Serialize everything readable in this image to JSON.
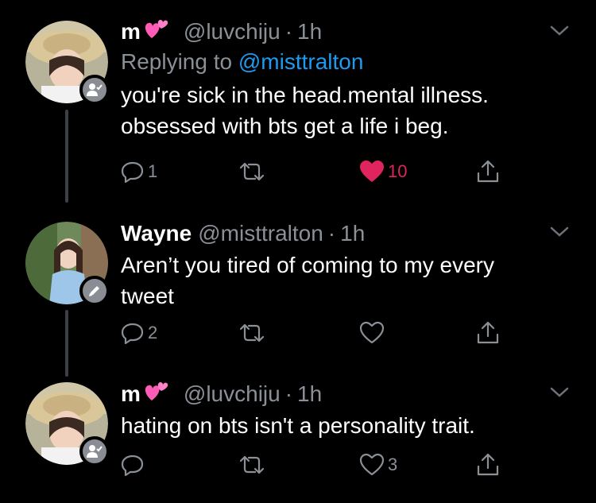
{
  "tweets": [
    {
      "name": "m",
      "emoji": "two-hearts",
      "handle": "@luvchiju",
      "separator": "·",
      "time": "1h",
      "replying_prefix": "Replying to",
      "replying_to": "@misttralton",
      "text_lines": [
        "you're sick in the head.mental illness.",
        "obsessed with bts get a life i beg."
      ],
      "replies": "1",
      "retweets": "",
      "likes": "10",
      "liked": true,
      "badge_icon": "user-check-icon"
    },
    {
      "name": "Wayne",
      "handle": "@misttralton",
      "separator": "·",
      "time": "1h",
      "text_lines": [
        "Aren’t you tired of coming to my every",
        "tweet"
      ],
      "replies": "2",
      "retweets": "",
      "likes": "",
      "liked": false,
      "badge_icon": "pencil-icon"
    },
    {
      "name": "m",
      "emoji": "two-hearts",
      "handle": "@luvchiju",
      "separator": "·",
      "time": "1h",
      "text_lines": [
        "hating on bts isn't a personality trait."
      ],
      "replies": "",
      "retweets": "",
      "likes": "3",
      "liked": false,
      "badge_icon": "user-check-icon"
    }
  ],
  "colors": {
    "background": "#000000",
    "text": "#ffffff",
    "muted": "#8b9096",
    "mention": "#1d9bf0",
    "like_active": "#e0245e",
    "connector": "#3d4147"
  }
}
